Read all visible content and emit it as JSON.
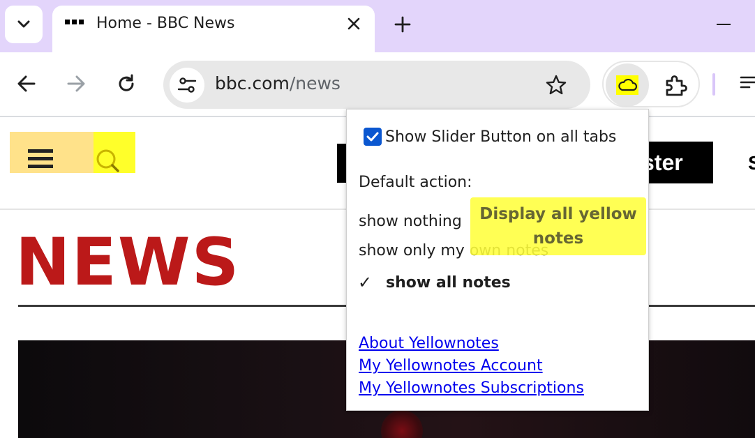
{
  "browser": {
    "tab": {
      "title": "Home - BBC News"
    },
    "url": {
      "domain": "bbc.com",
      "path": "/news"
    }
  },
  "page": {
    "logo_text": "NEWS",
    "register_label_fragment": "ster",
    "signin_label_fragment": "S"
  },
  "popup": {
    "show_slider_label": "Show Slider Button on all tabs",
    "show_slider_checked": true,
    "default_action_label": "Default action:",
    "options": [
      {
        "label": "show nothing",
        "selected": false
      },
      {
        "label": "show only my own notes",
        "selected": false
      },
      {
        "label": "show all notes",
        "selected": true
      }
    ],
    "selected_mark": "✓",
    "tooltip": "Display all yellow notes",
    "links": {
      "about": "About Yellownotes",
      "account": "My Yellownotes Account",
      "subscriptions": "My Yellownotes Subscriptions"
    }
  },
  "colors": {
    "tabstrip": "#e3d5fb",
    "highlight_yellow": "#ffff00",
    "bbc_red": "#bb1919",
    "checkbox_blue": "#0b57d0",
    "link_blue": "#0000ee"
  },
  "icons": {
    "tab_search": "chevron-down-icon",
    "favicon": "bbc-favicon",
    "close": "close-icon",
    "new_tab": "plus-icon",
    "minimize": "minimize-icon",
    "back": "arrow-left-icon",
    "forward": "arrow-right-icon",
    "reload": "reload-icon",
    "site_info": "tune-icon",
    "bookmark": "star-icon",
    "yellownotes": "cloud-icon",
    "extensions": "puzzle-icon",
    "menu": "menu-icon"
  }
}
